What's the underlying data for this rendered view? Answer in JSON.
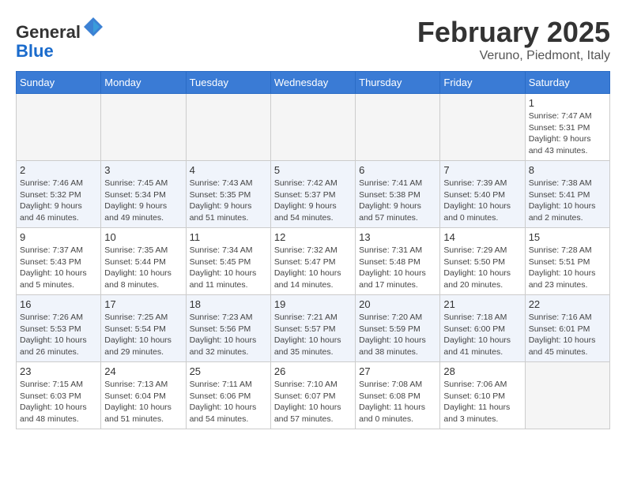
{
  "header": {
    "logo_general": "General",
    "logo_blue": "Blue",
    "month_title": "February 2025",
    "location": "Veruno, Piedmont, Italy"
  },
  "weekdays": [
    "Sunday",
    "Monday",
    "Tuesday",
    "Wednesday",
    "Thursday",
    "Friday",
    "Saturday"
  ],
  "weeks": [
    [
      {
        "day": "",
        "info": ""
      },
      {
        "day": "",
        "info": ""
      },
      {
        "day": "",
        "info": ""
      },
      {
        "day": "",
        "info": ""
      },
      {
        "day": "",
        "info": ""
      },
      {
        "day": "",
        "info": ""
      },
      {
        "day": "1",
        "info": "Sunrise: 7:47 AM\nSunset: 5:31 PM\nDaylight: 9 hours and 43 minutes."
      }
    ],
    [
      {
        "day": "2",
        "info": "Sunrise: 7:46 AM\nSunset: 5:32 PM\nDaylight: 9 hours and 46 minutes."
      },
      {
        "day": "3",
        "info": "Sunrise: 7:45 AM\nSunset: 5:34 PM\nDaylight: 9 hours and 49 minutes."
      },
      {
        "day": "4",
        "info": "Sunrise: 7:43 AM\nSunset: 5:35 PM\nDaylight: 9 hours and 51 minutes."
      },
      {
        "day": "5",
        "info": "Sunrise: 7:42 AM\nSunset: 5:37 PM\nDaylight: 9 hours and 54 minutes."
      },
      {
        "day": "6",
        "info": "Sunrise: 7:41 AM\nSunset: 5:38 PM\nDaylight: 9 hours and 57 minutes."
      },
      {
        "day": "7",
        "info": "Sunrise: 7:39 AM\nSunset: 5:40 PM\nDaylight: 10 hours and 0 minutes."
      },
      {
        "day": "8",
        "info": "Sunrise: 7:38 AM\nSunset: 5:41 PM\nDaylight: 10 hours and 2 minutes."
      }
    ],
    [
      {
        "day": "9",
        "info": "Sunrise: 7:37 AM\nSunset: 5:43 PM\nDaylight: 10 hours and 5 minutes."
      },
      {
        "day": "10",
        "info": "Sunrise: 7:35 AM\nSunset: 5:44 PM\nDaylight: 10 hours and 8 minutes."
      },
      {
        "day": "11",
        "info": "Sunrise: 7:34 AM\nSunset: 5:45 PM\nDaylight: 10 hours and 11 minutes."
      },
      {
        "day": "12",
        "info": "Sunrise: 7:32 AM\nSunset: 5:47 PM\nDaylight: 10 hours and 14 minutes."
      },
      {
        "day": "13",
        "info": "Sunrise: 7:31 AM\nSunset: 5:48 PM\nDaylight: 10 hours and 17 minutes."
      },
      {
        "day": "14",
        "info": "Sunrise: 7:29 AM\nSunset: 5:50 PM\nDaylight: 10 hours and 20 minutes."
      },
      {
        "day": "15",
        "info": "Sunrise: 7:28 AM\nSunset: 5:51 PM\nDaylight: 10 hours and 23 minutes."
      }
    ],
    [
      {
        "day": "16",
        "info": "Sunrise: 7:26 AM\nSunset: 5:53 PM\nDaylight: 10 hours and 26 minutes."
      },
      {
        "day": "17",
        "info": "Sunrise: 7:25 AM\nSunset: 5:54 PM\nDaylight: 10 hours and 29 minutes."
      },
      {
        "day": "18",
        "info": "Sunrise: 7:23 AM\nSunset: 5:56 PM\nDaylight: 10 hours and 32 minutes."
      },
      {
        "day": "19",
        "info": "Sunrise: 7:21 AM\nSunset: 5:57 PM\nDaylight: 10 hours and 35 minutes."
      },
      {
        "day": "20",
        "info": "Sunrise: 7:20 AM\nSunset: 5:59 PM\nDaylight: 10 hours and 38 minutes."
      },
      {
        "day": "21",
        "info": "Sunrise: 7:18 AM\nSunset: 6:00 PM\nDaylight: 10 hours and 41 minutes."
      },
      {
        "day": "22",
        "info": "Sunrise: 7:16 AM\nSunset: 6:01 PM\nDaylight: 10 hours and 45 minutes."
      }
    ],
    [
      {
        "day": "23",
        "info": "Sunrise: 7:15 AM\nSunset: 6:03 PM\nDaylight: 10 hours and 48 minutes."
      },
      {
        "day": "24",
        "info": "Sunrise: 7:13 AM\nSunset: 6:04 PM\nDaylight: 10 hours and 51 minutes."
      },
      {
        "day": "25",
        "info": "Sunrise: 7:11 AM\nSunset: 6:06 PM\nDaylight: 10 hours and 54 minutes."
      },
      {
        "day": "26",
        "info": "Sunrise: 7:10 AM\nSunset: 6:07 PM\nDaylight: 10 hours and 57 minutes."
      },
      {
        "day": "27",
        "info": "Sunrise: 7:08 AM\nSunset: 6:08 PM\nDaylight: 11 hours and 0 minutes."
      },
      {
        "day": "28",
        "info": "Sunrise: 7:06 AM\nSunset: 6:10 PM\nDaylight: 11 hours and 3 minutes."
      },
      {
        "day": "",
        "info": ""
      }
    ]
  ]
}
